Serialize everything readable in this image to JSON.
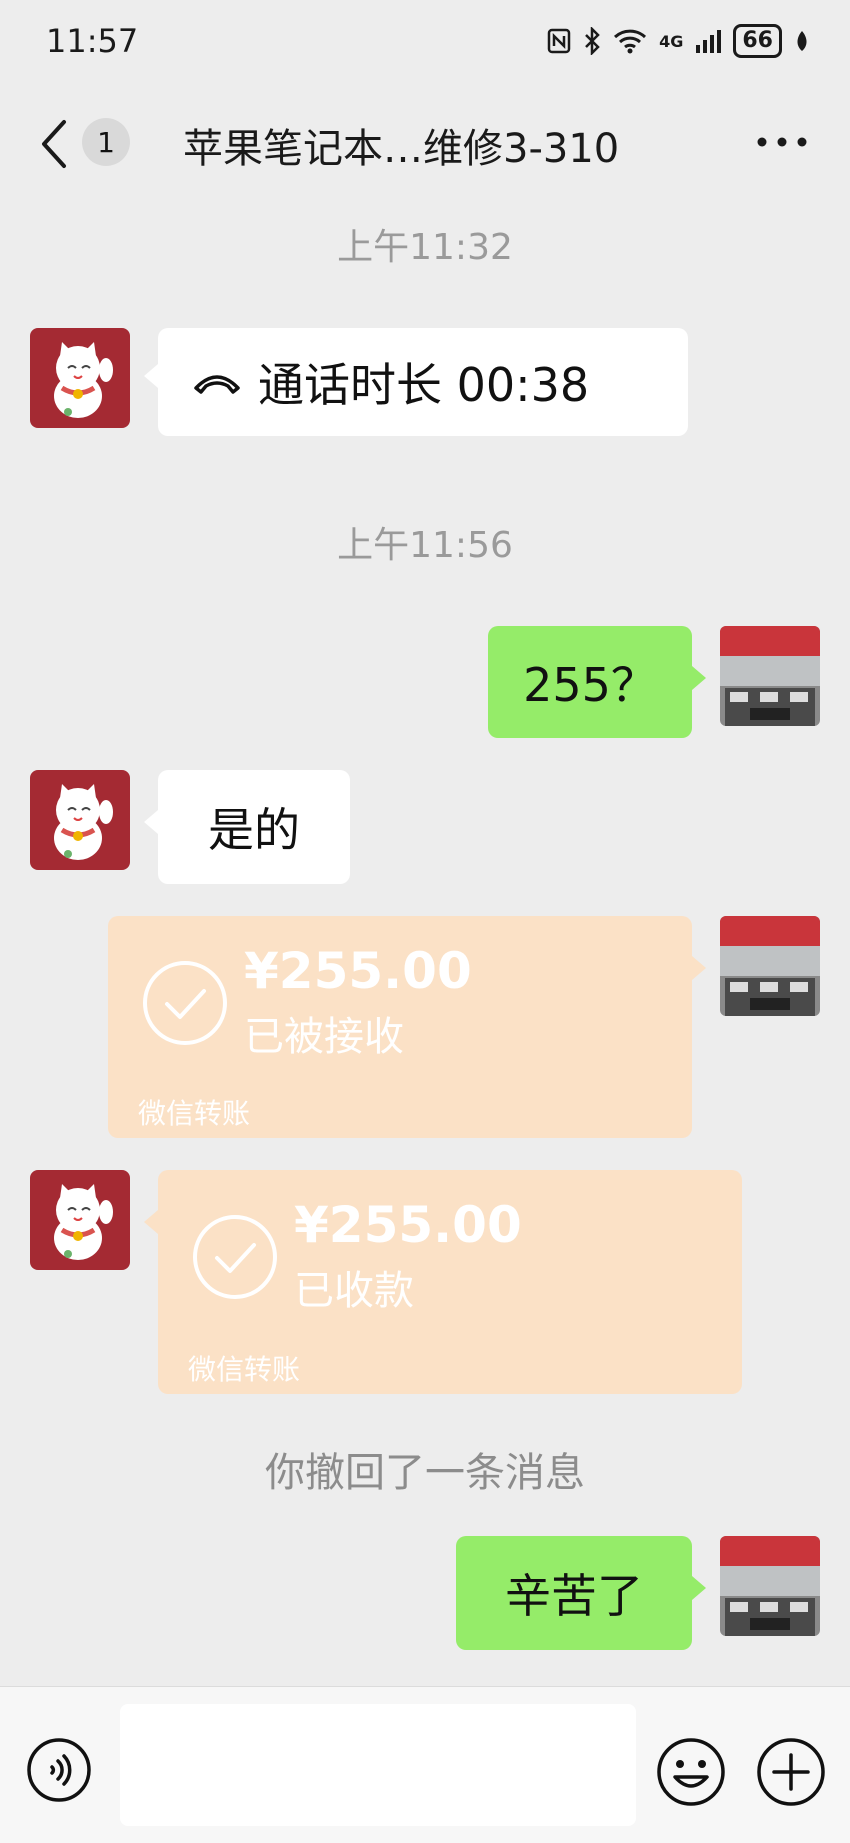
{
  "status_bar": {
    "time": "11:57",
    "network": "4G",
    "battery": "66"
  },
  "header": {
    "unread_count": "1",
    "title": "苹果笔记本…维修3-310"
  },
  "messages": {
    "time1": "上午11:32",
    "call": {
      "icon": "phone-hangup-icon",
      "text": "通话时长 00:38"
    },
    "time2": "上午11:56",
    "sent1": "255？",
    "recv1": "是的",
    "transfer_sent": {
      "amount": "¥255.00",
      "status": "已被接收",
      "label": "微信转账"
    },
    "transfer_recv": {
      "amount": "¥255.00",
      "status": "已收款",
      "label": "微信转账"
    },
    "recall_notice": "你撤回了一条消息",
    "sent2": "辛苦了"
  },
  "input_bar": {
    "icons": [
      "voice-icon",
      "emoji-icon",
      "plus-icon"
    ]
  },
  "colors": {
    "background": "#ededed",
    "green_bubble": "#95ec69",
    "transfer_card": "#fbe1c6",
    "avatar_red": "#a42a33"
  }
}
